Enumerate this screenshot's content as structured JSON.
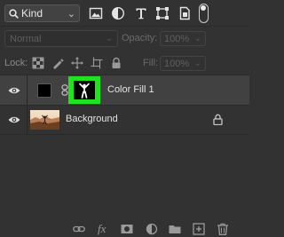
{
  "filter_bar": {
    "kind_label": "Kind",
    "icons": [
      "search-icon",
      "pixel-layer-filter-icon",
      "adjustment-layer-filter-icon",
      "type-layer-filter-icon",
      "shape-layer-filter-icon",
      "smart-object-filter-icon",
      "filter-toggle"
    ]
  },
  "blend_row": {
    "blend_mode": "Normal",
    "opacity_label": "Opacity:",
    "opacity_value": "100%"
  },
  "lock_row": {
    "lock_label": "Lock:",
    "fill_label": "Fill:",
    "fill_value": "100%",
    "icons": [
      "lock-transparent-pixels-icon",
      "lock-image-pixels-icon",
      "lock-position-icon",
      "lock-artboard-icon",
      "lock-all-icon"
    ]
  },
  "layers": [
    {
      "name": "Color Fill 1",
      "visible": true,
      "selected": true,
      "fill_color": "#000000",
      "mask_highlight": "#1ee31e"
    },
    {
      "name": "Background",
      "visible": true,
      "selected": false,
      "locked": true
    }
  ],
  "bottom_bar": {
    "fx_label": "fx",
    "icons": [
      "link-layers-icon",
      "layer-style-icon",
      "add-mask-icon",
      "new-adjustment-layer-icon",
      "new-group-icon",
      "new-layer-icon",
      "delete-layer-icon"
    ]
  },
  "colors": {
    "panel_bg": "#323232",
    "selected_row_bg": "#414141",
    "mask_highlight": "#1ee31e"
  }
}
